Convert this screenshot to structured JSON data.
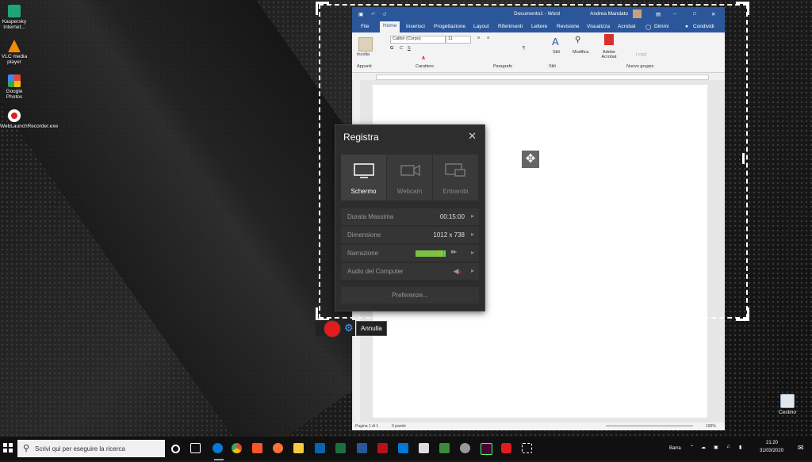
{
  "desktop": {
    "icons": [
      {
        "label": "Kaspersky Internet...",
        "color": "#1ea57a"
      },
      {
        "label": "VLC media player",
        "color": "#f48b00"
      },
      {
        "label": "Google Photos",
        "color": "#4285f4"
      },
      {
        "label": "WebLaunchRecorder.exe",
        "color": "#e21c1c"
      }
    ],
    "recycle_bin": "Cestino"
  },
  "word": {
    "title": "Documento1 - Word",
    "user": "Andrea Mandato",
    "tabs": [
      "File",
      "Home",
      "Inserisci",
      "Progettazione",
      "Layout",
      "Riferimenti",
      "Lettere",
      "Revisione",
      "Visualizza",
      "Acrobat",
      "Dimmi",
      "Condividi"
    ],
    "font_name": "Calibri (Corpo)",
    "font_size": "11",
    "groups": [
      "Appunti",
      "Carattere",
      "Paragrafo",
      "Stili",
      "Nuovo gruppo"
    ],
    "buttons": {
      "paste": "Incolla",
      "styles": "Stili",
      "edit": "Modifica",
      "adobe": "Adobe Acrobat",
      "read": "Leggi"
    },
    "status": {
      "page": "Pagina 1 di 1",
      "words": "0 parole",
      "zoom": "100%"
    }
  },
  "recorder": {
    "title": "Registra",
    "modes": [
      {
        "label": "Schermo",
        "selected": true
      },
      {
        "label": "Webcam",
        "selected": false
      },
      {
        "label": "Entrambi",
        "selected": false
      }
    ],
    "rows": [
      {
        "key": "Durata Massima",
        "value": "00:15:00"
      },
      {
        "key": "Dimensione",
        "value": "1012 x 738"
      },
      {
        "key": "Narrazione",
        "value": ""
      },
      {
        "key": "Audio del Computer",
        "value": ""
      }
    ],
    "preferences": "Preferenze...",
    "cancel": "Annulla"
  },
  "taskbar": {
    "search_placeholder": "Scrivi qui per eseguire la ricerca",
    "tray_label": "Barra",
    "time": "21:20",
    "date": "31/03/2020"
  },
  "colors": {
    "word_blue": "#2b579a",
    "record_red": "#e21c1c",
    "accent_blue": "#4a9eff"
  }
}
